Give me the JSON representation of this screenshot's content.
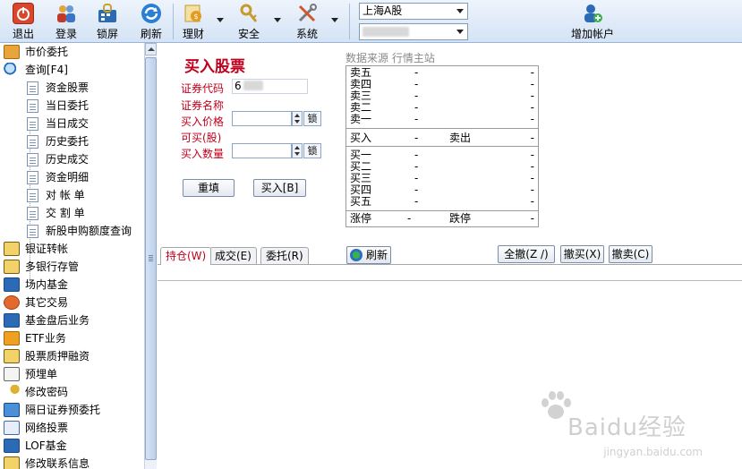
{
  "toolbar": {
    "buttons": [
      {
        "label": "退出",
        "icon": "power-icon",
        "color": "#d9462b"
      },
      {
        "label": "登录",
        "icon": "users-icon",
        "color": "#3a73c8"
      },
      {
        "label": "锁屏",
        "icon": "lock-screen-icon",
        "color": "#2b6bb5"
      },
      {
        "label": "刷新",
        "icon": "refresh-icon",
        "color": "#2a7fd4"
      },
      {
        "label": "理财",
        "icon": "finance-icon",
        "color": "#e49b1f"
      },
      {
        "label": "安全",
        "icon": "key-icon",
        "color": "#c69a2b"
      },
      {
        "label": "系统",
        "icon": "tools-icon",
        "color": "#d4562a"
      }
    ],
    "market_select": "上海A股",
    "account_select": "",
    "add_account_label": "增加帐户"
  },
  "sidebar": {
    "items": [
      {
        "label": "市价委托",
        "icon": "market-order-icon"
      },
      {
        "label": "查询[F4]",
        "icon": "query-icon"
      },
      {
        "label": "银证转帐",
        "icon": "transfer-icon"
      },
      {
        "label": "多银行存管",
        "icon": "multi-bank-icon"
      },
      {
        "label": "场内基金",
        "icon": "fund-icon"
      },
      {
        "label": "其它交易",
        "icon": "other-trade-icon"
      },
      {
        "label": "基金盘后业务",
        "icon": "fund-after-hours-icon"
      },
      {
        "label": "ETF业务",
        "icon": "etf-icon"
      },
      {
        "label": "股票质押融资",
        "icon": "pledge-icon"
      },
      {
        "label": "预埋单",
        "icon": "pre-order-icon"
      },
      {
        "label": "修改密码",
        "icon": "password-key-icon"
      },
      {
        "label": "隔日证券预委托",
        "icon": "next-day-order-icon"
      },
      {
        "label": "网络投票",
        "icon": "vote-icon"
      },
      {
        "label": "LOF基金",
        "icon": "lof-fund-icon"
      },
      {
        "label": "修改联系信息",
        "icon": "contact-info-icon"
      }
    ],
    "sub_items": [
      "资金股票",
      "当日委托",
      "当日成交",
      "历史委托",
      "历史成交",
      "资金明细",
      "对 帐 单",
      "交 割 单",
      "新股申购额度查询"
    ]
  },
  "form": {
    "title": "买入股票",
    "code_label": "证券代码",
    "code_value": "6",
    "name_label": "证券名称",
    "price_label": "买入价格",
    "available_label": "可买(股)",
    "qty_label": "买入数量",
    "lock_label": "锁",
    "reset_label": "重填",
    "buy_label": "买入[B]"
  },
  "quote": {
    "source_label": "数据来源 行情主站",
    "sells": [
      {
        "name": "卖五",
        "price": "-",
        "vol": "-"
      },
      {
        "name": "卖四",
        "price": "-",
        "vol": "-"
      },
      {
        "name": "卖三",
        "price": "-",
        "vol": "-"
      },
      {
        "name": "卖二",
        "price": "-",
        "vol": "-"
      },
      {
        "name": "卖一",
        "price": "-",
        "vol": "-"
      }
    ],
    "buy_in_label": "买入",
    "buy_in_value": "-",
    "sell_out_label": "卖出",
    "sell_out_value": "-",
    "buys": [
      {
        "name": "买一",
        "price": "-",
        "vol": "-"
      },
      {
        "name": "买二",
        "price": "-",
        "vol": "-"
      },
      {
        "name": "买三",
        "price": "-",
        "vol": "-"
      },
      {
        "name": "买四",
        "price": "-",
        "vol": "-"
      },
      {
        "name": "买五",
        "price": "-",
        "vol": "-"
      }
    ],
    "limit_up_label": "涨停",
    "limit_up_value": "-",
    "limit_down_label": "跌停",
    "limit_down_value": "-"
  },
  "tabs": [
    {
      "label": "持仓(W)",
      "active": true
    },
    {
      "label": "成交(E)",
      "active": false
    },
    {
      "label": "委托(R)",
      "active": false
    }
  ],
  "actions": {
    "refresh_label": "刷新",
    "cancel_all_label": "全撤(Z /)",
    "cancel_buy_label": "撤买(X)",
    "cancel_sell_label": "撤卖(C)"
  },
  "watermark": {
    "brand": "Baidu经验",
    "url": "jingyan.baidu.com"
  }
}
